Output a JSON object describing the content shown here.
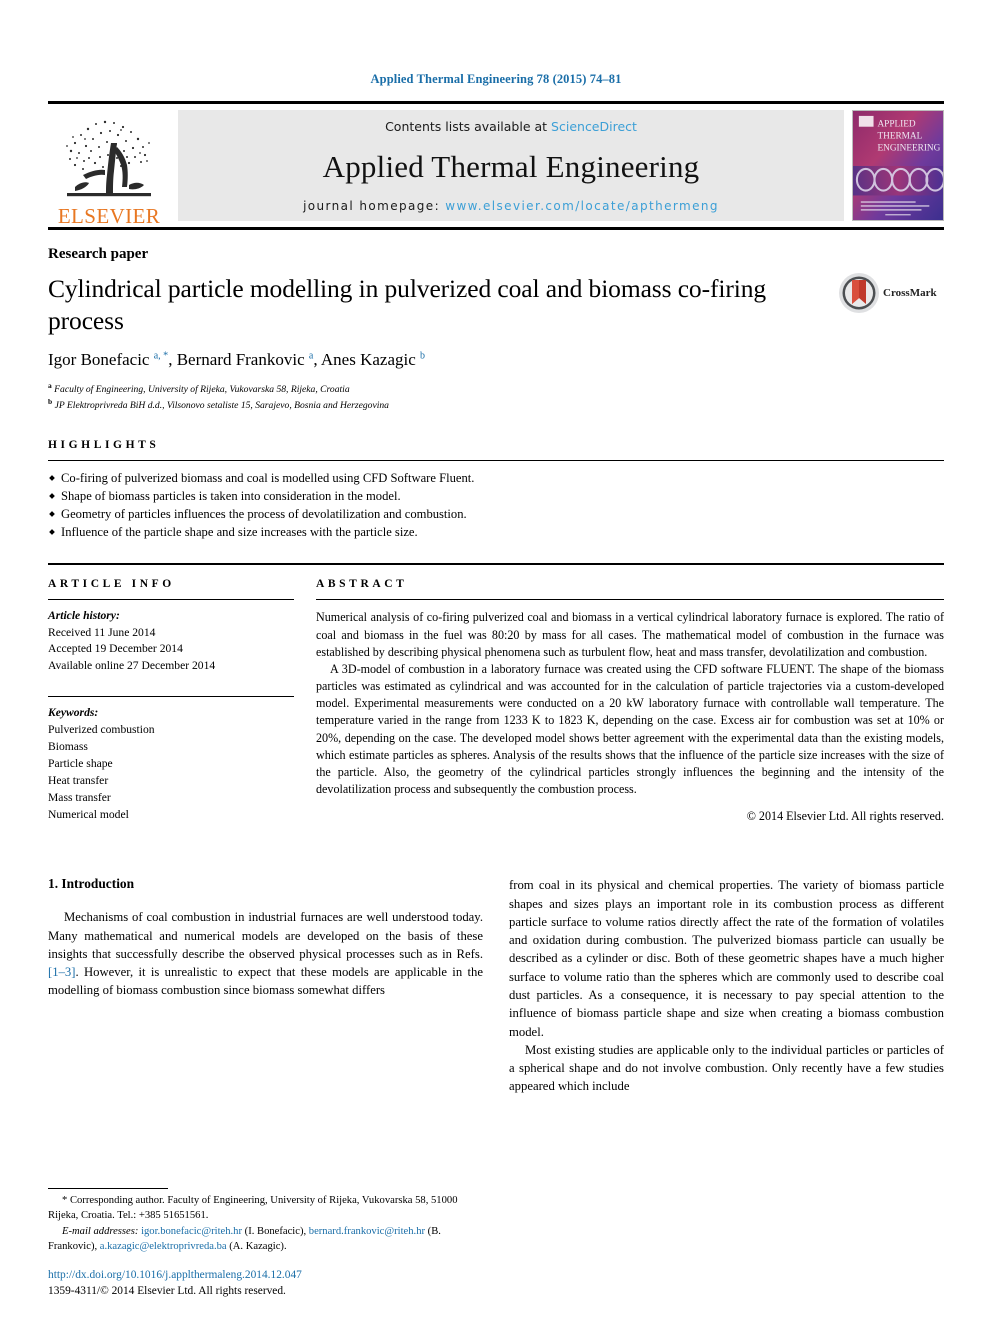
{
  "running_head": "Applied Thermal Engineering 78 (2015) 74–81",
  "masthead": {
    "elsevier_wordmark": "ELSEVIER",
    "contents_prefix": "Contents lists available at ",
    "sciencedirect": "ScienceDirect",
    "journal_title": "Applied Thermal Engineering",
    "homepage_prefix": "journal homepage: ",
    "homepage_url": "www.elsevier.com/locate/apthermeng",
    "cover_title_lines": [
      "APPLIED",
      "THERMAL",
      "ENGINEERING"
    ],
    "accent_link_color": "#3c9fd6",
    "elsevier_orange": "#E87722"
  },
  "article": {
    "type_label": "Research paper",
    "title": "Cylindrical particle modelling in pulverized coal and biomass co-firing process",
    "authors_html": "Igor Bonefacic <sup>a, *</sup>, Bernard Frankovic <sup>a</sup>, Anes Kazagic <sup>b</sup>",
    "affiliations": [
      {
        "marker": "a",
        "text": "Faculty of Engineering, University of Rijeka, Vukovarska 58, Rijeka, Croatia"
      },
      {
        "marker": "b",
        "text": "JP Elektroprivreda BiH d.d., Vilsonovo setaliste 15, Sarajevo, Bosnia and Herzegovina"
      }
    ],
    "crossmark_label": "CrossMark"
  },
  "highlights": {
    "heading": "HIGHLIGHTS",
    "items": [
      "Co-firing of pulverized biomass and coal is modelled using CFD Software Fluent.",
      "Shape of biomass particles is taken into consideration in the model.",
      "Geometry of particles influences the process of devolatilization and combustion.",
      "Influence of the particle shape and size increases with the particle size."
    ]
  },
  "article_info": {
    "heading": "ARTICLE INFO",
    "history_label": "Article history:",
    "history": [
      "Received 11 June 2014",
      "Accepted 19 December 2014",
      "Available online 27 December 2014"
    ],
    "keywords_label": "Keywords:",
    "keywords": [
      "Pulverized combustion",
      "Biomass",
      "Particle shape",
      "Heat transfer",
      "Mass transfer",
      "Numerical model"
    ]
  },
  "abstract": {
    "heading": "ABSTRACT",
    "paragraphs": [
      "Numerical analysis of co-firing pulverized coal and biomass in a vertical cylindrical laboratory furnace is explored. The ratio of coal and biomass in the fuel was 80:20 by mass for all cases. The mathematical model of combustion in the furnace was established by describing physical phenomena such as turbulent flow, heat and mass transfer, devolatilization and combustion.",
      "A 3D-model of combustion in a laboratory furnace was created using the CFD software FLUENT. The shape of the biomass particles was estimated as cylindrical and was accounted for in the calculation of particle trajectories via a custom-developed model. Experimental measurements were conducted on a 20 kW laboratory furnace with controllable wall temperature. The temperature varied in the range from 1233 K to 1823 K, depending on the case. Excess air for combustion was set at 10% or 20%, depending on the case. The developed model shows better agreement with the experimental data than the existing models, which estimate particles as spheres. Analysis of the results shows that the influence of the particle size increases with the size of the particle. Also, the geometry of the cylindrical particles strongly influences the beginning and the intensity of the devolatilization process and subsequently the combustion process."
    ],
    "copyright": "© 2014 Elsevier Ltd. All rights reserved."
  },
  "introduction": {
    "heading": "1. Introduction",
    "left_paragraph_pre": "Mechanisms of coal combustion in industrial furnaces are well understood today. Many mathematical and numerical models are developed on the basis of these insights that successfully describe the observed physical processes such as in Refs. ",
    "left_citation": "[1–3]",
    "left_paragraph_post": ". However, it is unrealistic to expect that these models are applicable in the modelling of biomass combustion since biomass somewhat differs",
    "right_paragraph_1": "from coal in its physical and chemical properties. The variety of biomass particle shapes and sizes plays an important role in its combustion process as different particle surface to volume ratios directly affect the rate of the formation of volatiles and oxidation during combustion. The pulverized biomass particle can usually be described as a cylinder or disc. Both of these geometric shapes have a much higher surface to volume ratio than the spheres which are commonly used to describe coal dust particles. As a consequence, it is necessary to pay special attention to the influence of biomass particle shape and size when creating a biomass combustion model.",
    "right_paragraph_2": "Most existing studies are applicable only to the individual particles or particles of a spherical shape and do not involve combustion. Only recently have a few studies appeared which include"
  },
  "footnotes": {
    "corresponding_marker": "*",
    "corresponding_text": " Corresponding author. Faculty of Engineering, University of Rijeka, Vukovarska 58, 51000 Rijeka, Croatia. Tel.: +385 51651561.",
    "email_label": "E-mail addresses:",
    "email_1": "igor.bonefacic@riteh.hr",
    "email_1_name": " (I. Bonefacic), ",
    "email_2": "bernard.frankovic@riteh.hr",
    "email_2_name": " (B. Frankovic), ",
    "email_3": "a.kazagic@elektroprivreda.ba",
    "email_3_name": " (A. Kazagic).",
    "doi": "http://dx.doi.org/10.1016/j.applthermaleng.2014.12.047",
    "issn_line": "1359-4311/© 2014 Elsevier Ltd. All rights reserved."
  }
}
